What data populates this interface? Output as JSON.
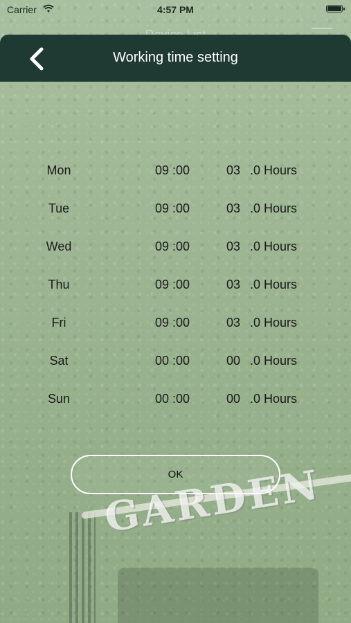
{
  "status_bar": {
    "carrier": "Carrier",
    "time": "4:57 PM"
  },
  "underlying_screen": {
    "title": "Device List"
  },
  "nav": {
    "title": "Working time setting",
    "back_icon": "chevron-left-icon"
  },
  "schedule": [
    {
      "day": "Mon",
      "start_time": "09 :00",
      "duration": "03",
      "unit": ".0 Hours"
    },
    {
      "day": "Tue",
      "start_time": "09 :00",
      "duration": "03",
      "unit": ".0 Hours"
    },
    {
      "day": "Wed",
      "start_time": "09 :00",
      "duration": "03",
      "unit": ".0 Hours"
    },
    {
      "day": "Thu",
      "start_time": "09 :00",
      "duration": "03",
      "unit": ".0 Hours"
    },
    {
      "day": "Fri",
      "start_time": "09 :00",
      "duration": "03",
      "unit": ".0 Hours"
    },
    {
      "day": "Sat",
      "start_time": "00 :00",
      "duration": "00",
      "unit": ".0 Hours"
    },
    {
      "day": "Sun",
      "start_time": "00 :00",
      "duration": "00",
      "unit": ".0 Hours"
    }
  ],
  "ok_button": {
    "label": "OK"
  },
  "background_sign": {
    "text": "GARDEN"
  },
  "colors": {
    "nav_bg": "#1e3a33",
    "grass": "#9bb48f",
    "button_border": "#ffffff"
  }
}
